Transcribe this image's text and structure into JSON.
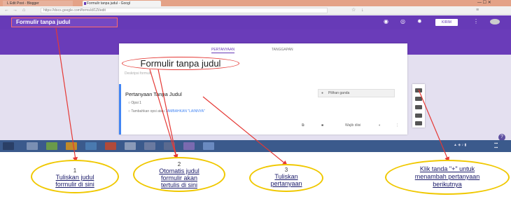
{
  "browser": {
    "tab1_label": "L  Edit Post - Blogger",
    "tab2_label": "Formulir tanpa judul - Googl",
    "url": "https://docs.google.com/forms/d/1Zt/edit",
    "window_controls": "—  ☐  ✕"
  },
  "forms_header": {
    "form_name": "Formulir tanpa judul",
    "send_label": "KIRIM"
  },
  "tabs": {
    "questions": "PERTANYAAN",
    "responses": "TANGGAPAN"
  },
  "form": {
    "title": "Formulir tanpa judul",
    "description": "Deskripsi formulir",
    "question_title": "Pertanyaan Tanpa Judul",
    "question_type": "Pilihan ganda",
    "option": "Opsi 1",
    "add_option": "Tambahkan opsi atau",
    "add_other": "TAMBAHKAN \"LAINNYA\"",
    "required_label": "Wajib diisi"
  },
  "annotations": {
    "callout1_num": "1",
    "callout1_text": "Tuliskan judul\nformulir di sini",
    "callout2_num": "2",
    "callout2_text": "Otomatis judul\nformulir akan\ntertulis di sini",
    "callout3_num": "3",
    "callout3_text": "Tuliskan\npertanyaan",
    "callout4_text": "Klik tanda \"+\"     untuk\nmenambah pertanyaan\nberikutnya",
    "arrow_color": "#e53935",
    "callout_border_color": "#f0c800"
  },
  "colors": {
    "forms_purple": "#673ab7",
    "accent_blue": "#4285f4"
  }
}
